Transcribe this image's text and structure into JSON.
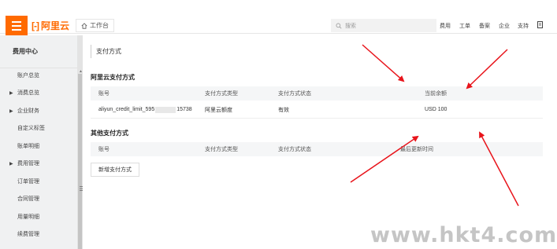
{
  "topbar": {
    "logo_mark": "[-]",
    "logo_text": "阿里云",
    "workbench_label": "工作台",
    "search_placeholder": "搜索",
    "nav": [
      "费用",
      "工单",
      "备案",
      "企业",
      "支持"
    ]
  },
  "sidebar": {
    "header": "费用中心",
    "items": [
      {
        "label": "账户总览",
        "expandable": false
      },
      {
        "label": "消费总览",
        "expandable": true
      },
      {
        "label": "企业财务",
        "expandable": true
      },
      {
        "label": "自定义标签",
        "expandable": false
      },
      {
        "label": "账单明细",
        "expandable": false
      },
      {
        "label": "费用管理",
        "expandable": true
      },
      {
        "label": "订单管理",
        "expandable": false
      },
      {
        "label": "合同管理",
        "expandable": false
      },
      {
        "label": "用量明细",
        "expandable": false
      },
      {
        "label": "续费管理",
        "expandable": false
      }
    ]
  },
  "main": {
    "page_title": "支付方式",
    "aliyun_section": {
      "title": "阿里云支付方式",
      "columns": [
        "账号",
        "支付方式类型",
        "支付方式状态",
        "当前余额"
      ],
      "row": {
        "account_prefix": "aliyun_credit_limit_595",
        "account_suffix": "15738",
        "type": "阿里云额度",
        "status": "有效",
        "balance": "USD 100"
      }
    },
    "other_section": {
      "title": "其他支付方式",
      "columns": [
        "账号",
        "支付方式类型",
        "支付方式状态",
        "最后更新时间"
      ]
    },
    "add_button": "新增支付方式"
  },
  "watermark": "www.hkt4.com",
  "colors": {
    "brand": "#ff6a00",
    "arrow": "#e8141b"
  }
}
